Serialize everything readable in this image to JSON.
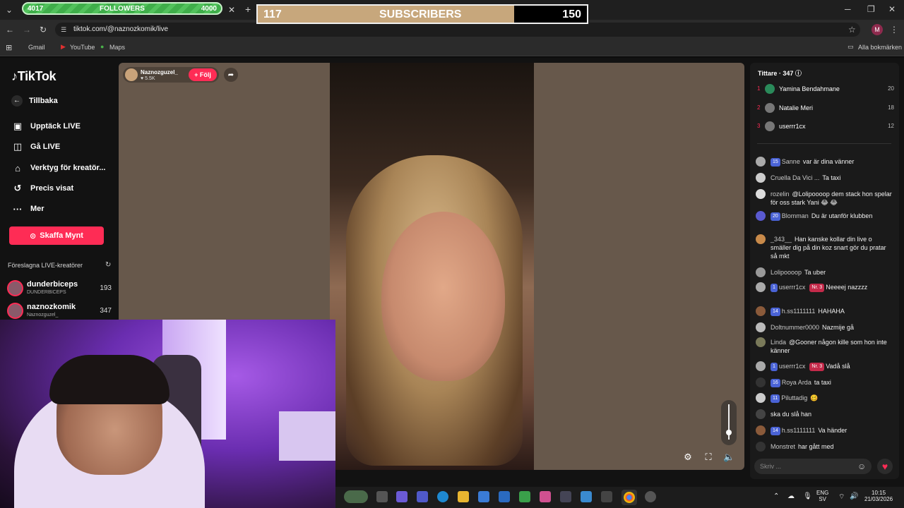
{
  "overlays": {
    "followers": {
      "current": "4017",
      "label": "FOLLOWERS",
      "goal": "4000"
    },
    "subscribers": {
      "current": "117",
      "label": "SUBSCRIBERS",
      "goal": "150",
      "progress": 0.78
    }
  },
  "browser": {
    "url": "tiktok.com/@naznozkomik/live",
    "bookmarks": [
      "Gmail",
      "YouTube",
      "Maps"
    ],
    "all_bookmarks": "Alla bokmärken",
    "profile_initial": "M"
  },
  "sidebar": {
    "logo": "TikTok",
    "back": "Tillbaka",
    "items": [
      {
        "label": "Upptäck LIVE",
        "icon": "calendar-live-icon"
      },
      {
        "label": "Gå LIVE",
        "icon": "video-camera-icon"
      },
      {
        "label": "Verktyg för kreatör...",
        "icon": "creator-tools-icon"
      },
      {
        "label": "Precis visat",
        "icon": "history-icon"
      },
      {
        "label": "Mer",
        "icon": "more-dots-icon"
      }
    ],
    "coins_button": "Skaffa Mynt",
    "suggested_header": "Föreslagna LIVE-kreatörer",
    "creators": [
      {
        "name": "dunderbiceps",
        "sub": "DUNDERBICEPS",
        "count": "193"
      },
      {
        "name": "naznozkomik",
        "sub": "Naznozguzel_",
        "count": "347"
      }
    ]
  },
  "player": {
    "host_name": "Naznozguzel_",
    "host_likes": "5.5K",
    "follow_label": "+ Följ",
    "volume_level": 0.2
  },
  "chat": {
    "viewers_label": "Tittare · 347",
    "top_viewers": [
      {
        "rank": "1",
        "name": "Yamina Bendahmane",
        "score": "20"
      },
      {
        "rank": "2",
        "name": "Natalie Meri",
        "score": "18"
      },
      {
        "rank": "3",
        "name": "userrr1cx",
        "score": "12"
      }
    ],
    "messages": [
      {
        "badge": "15",
        "user": "Sanne",
        "text": "var är dina vänner"
      },
      {
        "badge": "",
        "user": "Cruella Da Vici ...",
        "text": "Ta taxi"
      },
      {
        "badge": "",
        "user": "rozelin",
        "text": "@Lolipoooop dem stack hon spelar för oss stark Yani 😂 😂"
      },
      {
        "badge": "20",
        "user": "Blomman",
        "text": "Du är utanför klubben"
      },
      {
        "badge": "",
        "user": "_343__",
        "text": "Han kanske kollar din live o smäller dig på din koz snart gör du pratar så mkt"
      },
      {
        "badge": "",
        "user": "Lolipoooop",
        "text": "Ta uber"
      },
      {
        "badge": "1",
        "user": "userrr1cx",
        "extra": "Nr. 3",
        "text": "Neeeej nazzzz"
      },
      {
        "badge": "14",
        "user": "h.ss1111111",
        "text": "HAHAHA"
      },
      {
        "badge": "",
        "user": "Doltnummer0000",
        "text": "Nazmije gå"
      },
      {
        "badge": "",
        "user": "Linda",
        "text": "@Gooner någon kille som hon inte känner"
      },
      {
        "badge": "1",
        "user": "userrr1cx",
        "extra": "Nr. 3",
        "text": "Vadå slå"
      },
      {
        "badge": "16",
        "user": "Roya Arda",
        "text": "ta taxi"
      },
      {
        "badge": "11",
        "user": "Piluttadig",
        "text": "🥴"
      },
      {
        "badge": "",
        "user": "",
        "text": "ska du slå han"
      },
      {
        "badge": "14",
        "user": "h.ss1111111",
        "text": "Va händer"
      },
      {
        "badge": "",
        "user": "Monstret",
        "text": "har gått med"
      }
    ],
    "input_placeholder": "Skriv ..."
  },
  "taskbar": {
    "lang": "ENG",
    "region": "SV",
    "time": "10:15",
    "date": "21/03/2026"
  }
}
